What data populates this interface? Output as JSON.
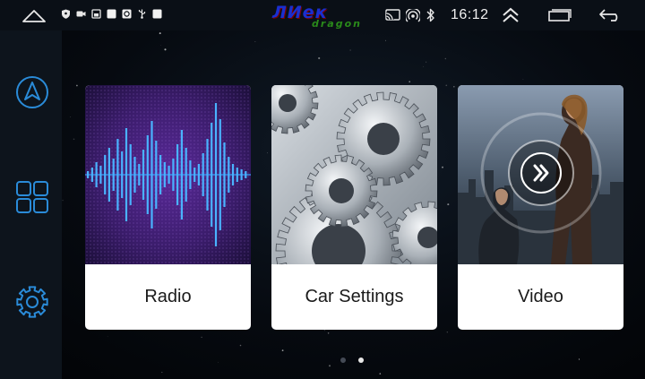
{
  "statusbar": {
    "home_icon": "home-outline-icon",
    "left_icons": [
      "shield-icon",
      "camera-icon",
      "sd-card-icon",
      "square-icon",
      "screenshot-icon",
      "usb-icon",
      "square-icon"
    ],
    "logo": {
      "top": "ЛИек",
      "bottom": "dragon"
    },
    "cast_icon": "cast-icon",
    "hotspot_icon": "hotspot-icon",
    "bluetooth_icon": "bluetooth-icon",
    "time": "16:12",
    "chevron_icon": "double-chevron-up-icon",
    "recent_icon": "recent-apps-icon",
    "back_icon": "back-icon"
  },
  "sidebar": {
    "items": [
      {
        "name": "navigation",
        "icon": "navigation-arrow-icon"
      },
      {
        "name": "apps",
        "icon": "apps-grid-icon"
      },
      {
        "name": "settings",
        "icon": "gear-icon"
      }
    ]
  },
  "cards": [
    {
      "label": "Radio",
      "image": "sound-wave-image"
    },
    {
      "label": "Car Settings",
      "image": "gears-image"
    },
    {
      "label": "Video",
      "image": "movie-poster-image"
    }
  ],
  "pager": {
    "count": 2,
    "active_index": 1
  },
  "colors": {
    "accent": "#2a8bd8",
    "statusbar_bg": "#0a0f16",
    "sidebar_bg": "#0d141c",
    "card_bg": "#ffffff"
  }
}
